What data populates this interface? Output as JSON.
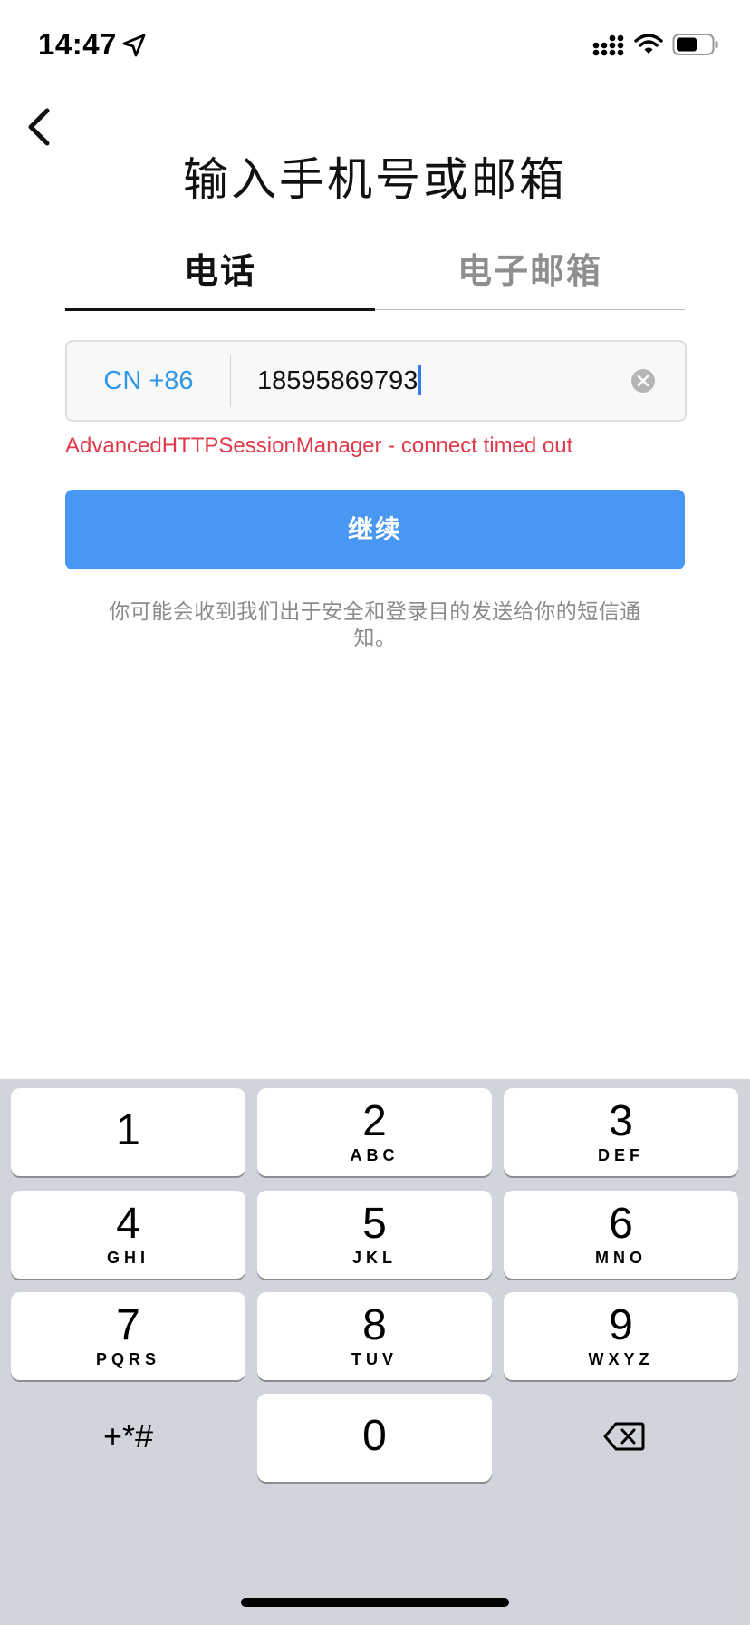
{
  "status_bar": {
    "time": "14:47",
    "icons": [
      "location-arrow-icon",
      "signal-icon",
      "wifi-icon",
      "battery-icon"
    ]
  },
  "header": {
    "back_icon": "chevron-left-icon",
    "title": "输入手机号或邮箱"
  },
  "tabs": [
    {
      "label": "电话",
      "active": true
    },
    {
      "label": "电子邮箱",
      "active": false
    }
  ],
  "phone_form": {
    "country_code": "CN +86",
    "phone_value": "18595869793",
    "clear_icon": "clear-circle-icon",
    "error_message": "AdvancedHTTPSessionManager - connect timed out",
    "continue_label": "继续",
    "notice": "你可能会收到我们出于安全和登录目的发送给你的短信通知。"
  },
  "keypad": {
    "keys": [
      {
        "digit": "1",
        "letters": ""
      },
      {
        "digit": "2",
        "letters": "ABC"
      },
      {
        "digit": "3",
        "letters": "DEF"
      },
      {
        "digit": "4",
        "letters": "GHI"
      },
      {
        "digit": "5",
        "letters": "JKL"
      },
      {
        "digit": "6",
        "letters": "MNO"
      },
      {
        "digit": "7",
        "letters": "PQRS"
      },
      {
        "digit": "8",
        "letters": "TUV"
      },
      {
        "digit": "9",
        "letters": "WXYZ"
      },
      {
        "digit": "0",
        "letters": ""
      }
    ],
    "symbols_label": "+*#",
    "delete_icon": "backspace-icon"
  },
  "colors": {
    "accent_blue": "#4797f3",
    "country_code_blue": "#2f96e8",
    "error_red": "#e0394a",
    "keypad_bg": "#d1d4db"
  }
}
